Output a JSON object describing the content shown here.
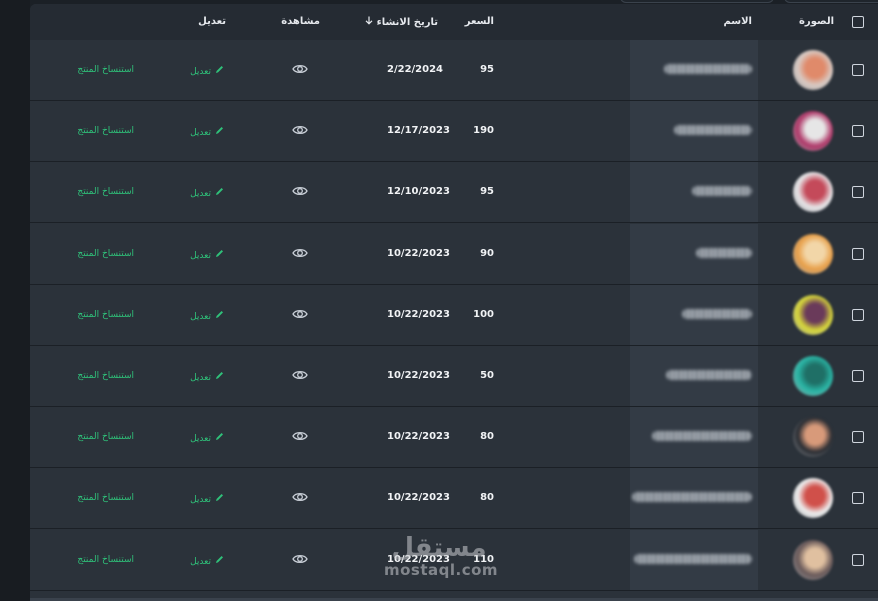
{
  "table": {
    "headers": {
      "image": "الصورة",
      "name": "الاسم",
      "price": "السعر",
      "created": "تاريخ الانشاء",
      "view": "مشاهدة",
      "edit": "تعديل"
    },
    "rows": [
      {
        "price": "95",
        "date": "2/22/2024",
        "edit": "تعديل",
        "clone": "استنساخ المنتج",
        "thumb_color": "#d8c9c2",
        "thumb_accent": "#e08a6a"
      },
      {
        "price": "190",
        "date": "12/17/2023",
        "edit": "تعديل",
        "clone": "استنساخ المنتج",
        "thumb_color": "#b03a6a",
        "thumb_accent": "#e6e6e6"
      },
      {
        "price": "95",
        "date": "12/10/2023",
        "edit": "تعديل",
        "clone": "استنساخ المنتج",
        "thumb_color": "#e6e4e6",
        "thumb_accent": "#c44a5a"
      },
      {
        "price": "90",
        "date": "10/22/2023",
        "edit": "تعديل",
        "clone": "استنساخ المنتج",
        "thumb_color": "#e8a04a",
        "thumb_accent": "#f2d6a8"
      },
      {
        "price": "100",
        "date": "10/22/2023",
        "edit": "تعديل",
        "clone": "استنساخ المنتج",
        "thumb_color": "#d6d63a",
        "thumb_accent": "#6a3a5a"
      },
      {
        "price": "50",
        "date": "10/22/2023",
        "edit": "تعديل",
        "clone": "استنساخ المنتج",
        "thumb_color": "#2ab5a5",
        "thumb_accent": "#1f6f66"
      },
      {
        "price": "80",
        "date": "10/22/2023",
        "edit": "تعديل",
        "clone": "استنساخ المنتج",
        "thumb_color": "#2a2d33",
        "thumb_accent": "#d89a7a"
      },
      {
        "price": "80",
        "date": "10/22/2023",
        "edit": "تعديل",
        "clone": "استنساخ المنتج",
        "thumb_color": "#ececec",
        "thumb_accent": "#d0504a"
      },
      {
        "price": "110",
        "date": "10/22/2023",
        "edit": "تعديل",
        "clone": "استنساخ المنتج",
        "thumb_color": "#6a5a5a",
        "thumb_accent": "#e0c0a0"
      }
    ]
  },
  "watermark": {
    "arabic": "مستقل",
    "latin": "mostaql.com"
  },
  "colors": {
    "accent_green": "#2fc27a",
    "panel": "#2b323a",
    "header": "#252b33"
  },
  "icons": {
    "view": "eye-icon",
    "edit": "pencil-icon",
    "sort": "arrow-down-icon"
  }
}
